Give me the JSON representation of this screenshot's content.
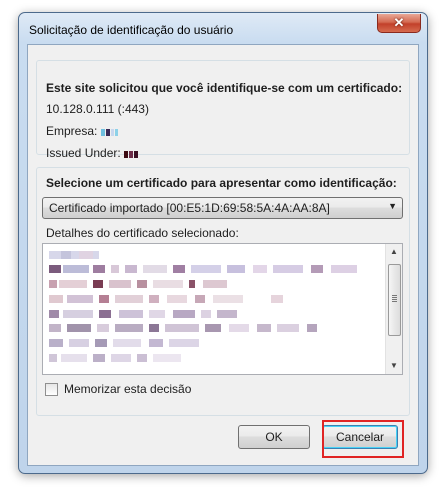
{
  "window": {
    "title": "Solicitação de identificação do usuário",
    "close_label": "✕"
  },
  "site_group": {
    "heading": "Este site solicitou que você identifique-se com um certificado:",
    "address": "10.128.0.111 (:443)",
    "company_label": "Empresa:",
    "issued_label": "Issued Under:"
  },
  "cert_group": {
    "heading": "Selecione um certificado para apresentar como identificação:",
    "selected_certificate": "Certificado importado [00:E5:1D:69:58:5A:4A:AA:8A]",
    "details_label": "Detalhes do certificado selecionado:"
  },
  "remember_label": "Memorizar esta decisão",
  "buttons": {
    "ok": "OK",
    "cancel": "Cancelar"
  },
  "colors": {
    "highlight": "#e02424",
    "client_bg": "#f0f0f0"
  }
}
